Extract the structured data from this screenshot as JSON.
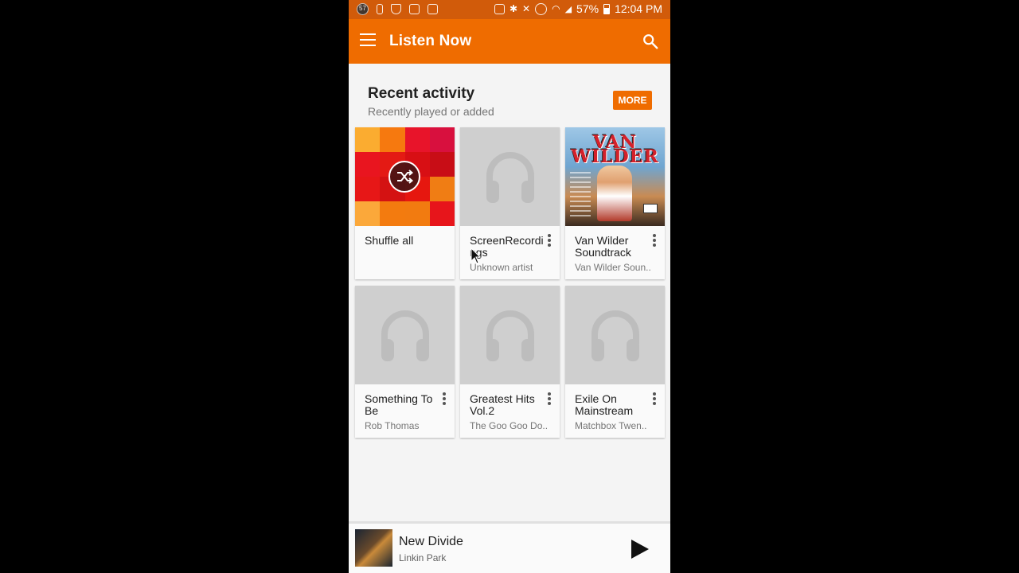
{
  "status_bar": {
    "notification_count": "57",
    "battery": "57%",
    "time": "12:04 PM"
  },
  "app_bar": {
    "title": "Listen Now",
    "menu_icon": "menu-icon",
    "search_icon": "search-icon"
  },
  "recent": {
    "title": "Recent activity",
    "subtitle": "Recently played or added",
    "more_label": "MORE"
  },
  "cards": [
    {
      "title": "Shuffle all",
      "subtitle": "",
      "art": "shuffle-mosaic"
    },
    {
      "title": "ScreenRecordings",
      "subtitle": "Unknown artist",
      "art": "headphones-placeholder"
    },
    {
      "title": "Van Wilder Soundtrack",
      "subtitle": "Van Wilder Soun..",
      "art": "album-cover",
      "art_text": "VAN WILDER"
    },
    {
      "title": "Something To Be",
      "subtitle": "Rob Thomas",
      "art": "headphones-placeholder"
    },
    {
      "title": "Greatest Hits Vol.2",
      "subtitle": "The Goo Goo Do..",
      "art": "headphones-placeholder"
    },
    {
      "title": "Exile On Mainstream",
      "subtitle": "Matchbox Twen..",
      "art": "headphones-placeholder"
    }
  ],
  "now_playing": {
    "title": "New Divide",
    "artist": "Linkin Park",
    "play_icon": "play-icon"
  },
  "colors": {
    "accent": "#ef6c00",
    "status_bar": "#d15b0a",
    "background": "#f4f4f4",
    "placeholder": "#cfcfcf"
  }
}
